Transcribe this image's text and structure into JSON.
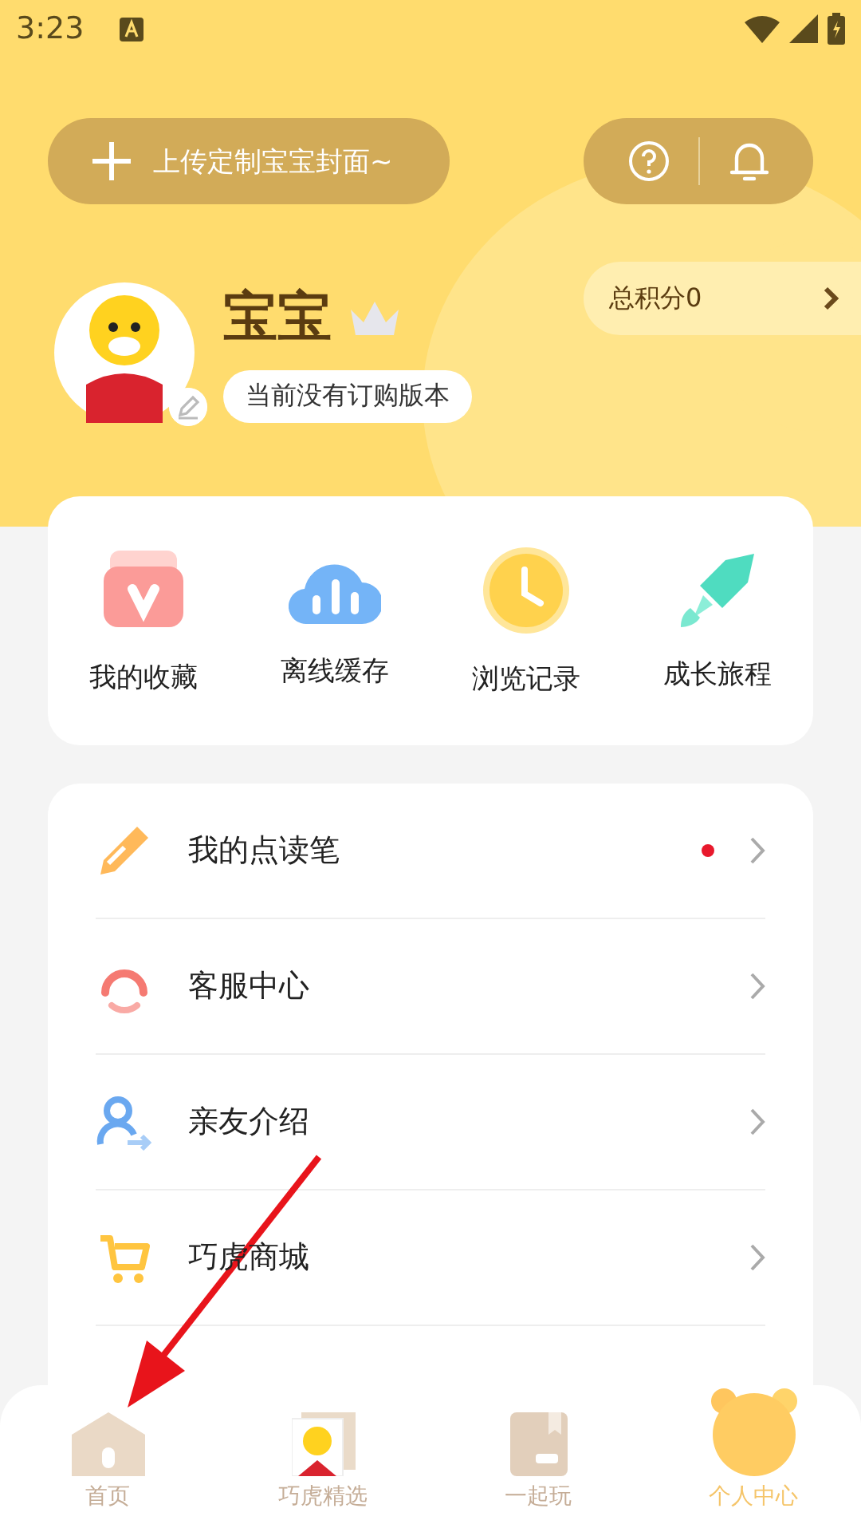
{
  "status_bar": {
    "time": "3:23"
  },
  "header": {
    "upload_button": "上传定制宝宝封面~",
    "name": "宝宝",
    "subscription_tag": "当前没有订购版本",
    "points": "总积分0"
  },
  "shortcuts": [
    {
      "kind": "favorites",
      "label": "我的收藏"
    },
    {
      "kind": "offline",
      "label": "离线缓存"
    },
    {
      "kind": "history",
      "label": "浏览记录"
    },
    {
      "kind": "growth",
      "label": "成长旅程"
    }
  ],
  "menu": [
    {
      "kind": "pen",
      "label": "我的点读笔",
      "dot": true
    },
    {
      "kind": "service",
      "label": "客服中心",
      "dot": false
    },
    {
      "kind": "invite",
      "label": "亲友介绍",
      "dot": false
    },
    {
      "kind": "shop",
      "label": "巧虎商城",
      "dot": false
    }
  ],
  "tab_bar": [
    {
      "kind": "home",
      "label": "首页",
      "selected": false
    },
    {
      "kind": "picks",
      "label": "巧虎精选",
      "selected": false
    },
    {
      "kind": "play",
      "label": "一起玩",
      "selected": false
    },
    {
      "kind": "me",
      "label": "个人中心",
      "selected": true
    }
  ]
}
